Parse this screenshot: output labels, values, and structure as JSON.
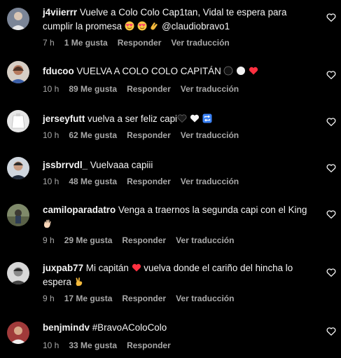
{
  "comments": [
    {
      "username": "j4viierrr",
      "text_line1": "Vuelve a Colo Colo Cap1tan, Vidal te espera para",
      "text_line2": "cumplir la promesa",
      "mention": "@claudiobravo1",
      "time": "7 h",
      "likes": "1 Me gusta",
      "reply": "Responder",
      "translate": "Ver traducción",
      "emojis": [
        "heart-eyes-emoji",
        "heart-eyes-emoji",
        "clap-emoji"
      ]
    },
    {
      "username": "fducoo",
      "text": "VUELVA A COLO COLO CAPITÁN",
      "time": "10 h",
      "likes": "89 Me gusta",
      "reply": "Responder",
      "translate": "Ver traducción",
      "emojis": [
        "black-circle-emoji",
        "white-circle-emoji",
        "red-heart-emoji"
      ]
    },
    {
      "username": "jerseyfutt",
      "text": "vuelva a ser feliz capi",
      "time": "10 h",
      "likes": "62 Me gusta",
      "reply": "Responder",
      "translate": "Ver traducción",
      "emojis": [
        "black-heart-emoji",
        "white-heart-emoji",
        "repeat-emoji"
      ]
    },
    {
      "username": "jssbrrvdl_",
      "text": "Vuelvaaa capiii",
      "time": "10 h",
      "likes": "48 Me gusta",
      "reply": "Responder",
      "translate": "Ver traducción"
    },
    {
      "username": "camiloparadatro",
      "text": "Venga a traernos la segunda capi con el King",
      "time": "9 h",
      "likes": "29 Me gusta",
      "reply": "Responder",
      "translate": "Ver traducción",
      "emojis": [
        "waving-hand-emoji"
      ]
    },
    {
      "username": "juxpab77",
      "text_part1": "Mi capitán",
      "text_part2": "vuelva donde el cariño del hincha lo",
      "text_line2": "espera",
      "time": "9 h",
      "likes": "17 Me gusta",
      "reply": "Responder",
      "translate": "Ver traducción",
      "emojis": [
        "red-heart-emoji",
        "victory-hand-emoji"
      ]
    },
    {
      "username": "benjmindv",
      "text": "#BravoAColoColo",
      "time": "10 h",
      "likes": "33 Me gusta",
      "reply": "Responder"
    }
  ],
  "colors": {
    "background": "#000000",
    "text": "#f5f5f5",
    "secondary": "#a8a8a8",
    "red_heart": "#ff3040"
  }
}
